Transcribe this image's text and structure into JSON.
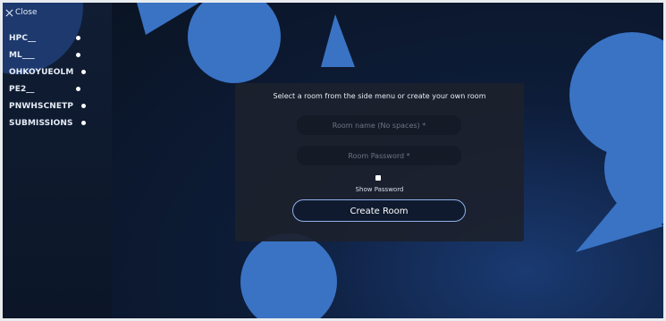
{
  "sidebar": {
    "close_label": "Close",
    "rooms": [
      {
        "label": "HPC__"
      },
      {
        "label": "ML___"
      },
      {
        "label": "OHKOYUEOLM"
      },
      {
        "label": "PE2__"
      },
      {
        "label": "PNWHSCNETP"
      },
      {
        "label": "SUBMISSIONS"
      }
    ]
  },
  "main": {
    "card": {
      "title": "Select a room from the side menu or create your own room",
      "room_name_placeholder": "Room name (No spaces) *",
      "room_password_placeholder": "Room Password *",
      "show_password_label": "Show Password",
      "create_button_label": "Create Room"
    }
  },
  "colors": {
    "background": "#0b1526",
    "accent_shapes": "#3a73c4",
    "card": "#1c212d",
    "button_border": "#8fb0ea"
  }
}
